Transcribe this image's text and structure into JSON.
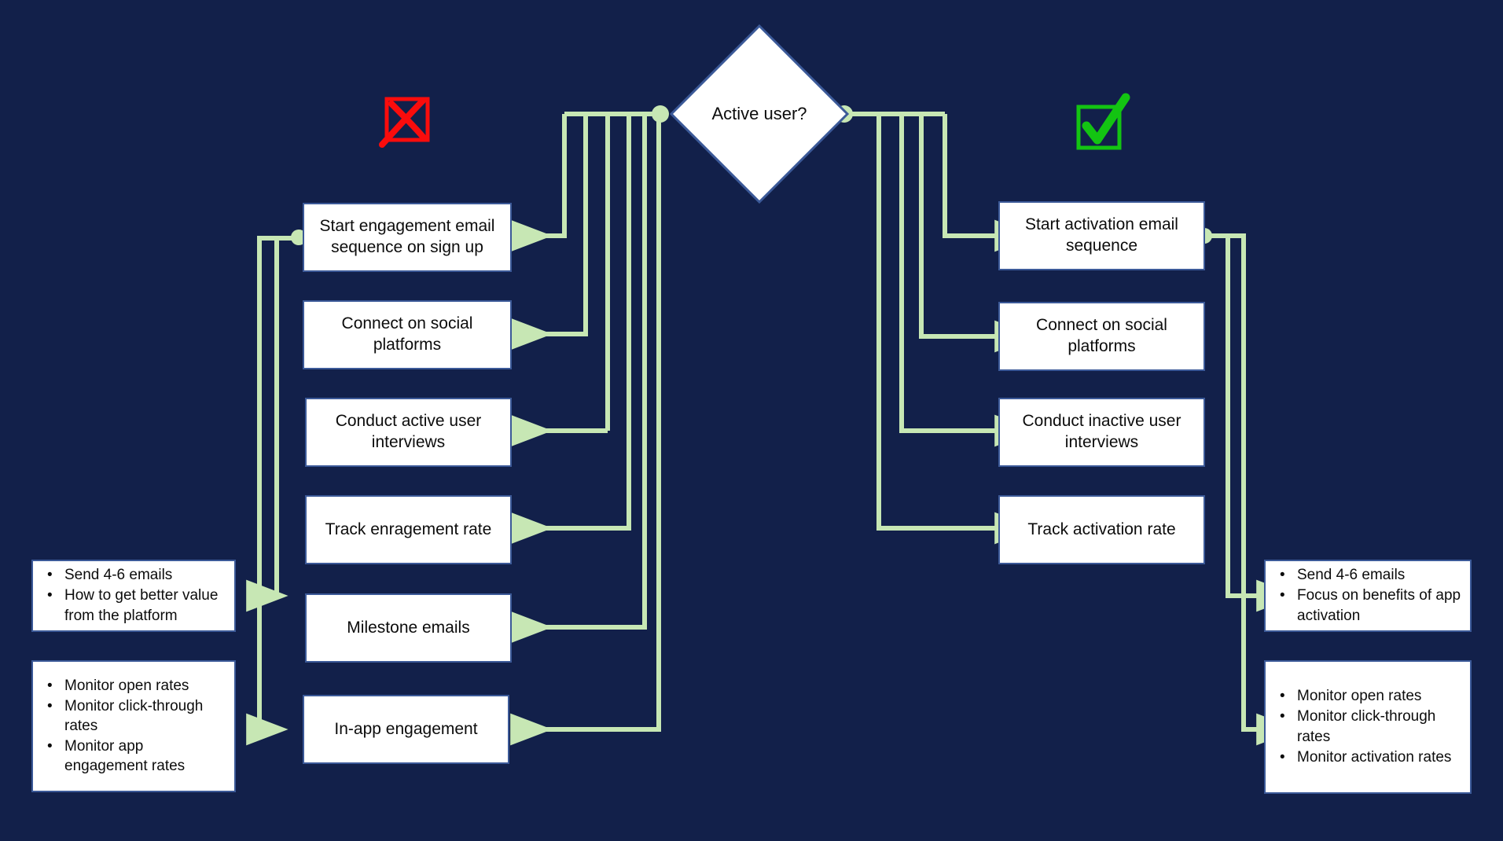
{
  "theme": {
    "background": "#12204a",
    "connector": "#c7e7b4",
    "node_fill": "#ffffff",
    "node_border": "#3b5998",
    "text": "#0c0c0c",
    "cross_icon": "#fa0c0c",
    "check_icon": "#13c412"
  },
  "decision": {
    "label_line1": "Active",
    "label_line2": "user?"
  },
  "badges": {
    "no_branch": {
      "icon": "red-x-checkbox-icon",
      "color": "#fa0c0c"
    },
    "yes_branch": {
      "icon": "green-check-checkbox-icon",
      "color": "#13c412"
    }
  },
  "left_branch": {
    "nodes": [
      {
        "line1": "Start engagement email",
        "line2": "sequence on sign up"
      },
      {
        "line1": "Connect on social",
        "line2": "platforms"
      },
      {
        "line1": "Conduct active user",
        "line2": "interviews"
      },
      {
        "line1": "Track enragement rate",
        "line2": ""
      },
      {
        "line1": "Milestone emails",
        "line2": ""
      },
      {
        "line1": "In-app engagement",
        "line2": ""
      }
    ],
    "detail_boxes": [
      {
        "items": [
          "Send 4-6 emails",
          "How to get better value from the platform"
        ]
      },
      {
        "items": [
          "Monitor open rates",
          "Monitor click-through rates",
          "Monitor app engagement rates"
        ]
      }
    ]
  },
  "right_branch": {
    "nodes": [
      {
        "line1": "Start activation email",
        "line2": "sequence"
      },
      {
        "line1": "Connect on social",
        "line2": "platforms"
      },
      {
        "line1": "Conduct inactive user",
        "line2": "interviews"
      },
      {
        "line1": "Track activation rate",
        "line2": ""
      }
    ],
    "detail_boxes": [
      {
        "items": [
          "Send 4-6 emails",
          "Focus on benefits of app activation"
        ]
      },
      {
        "items": [
          "Monitor open rates",
          "Monitor click-through rates",
          "Monitor activation rates"
        ]
      }
    ]
  }
}
